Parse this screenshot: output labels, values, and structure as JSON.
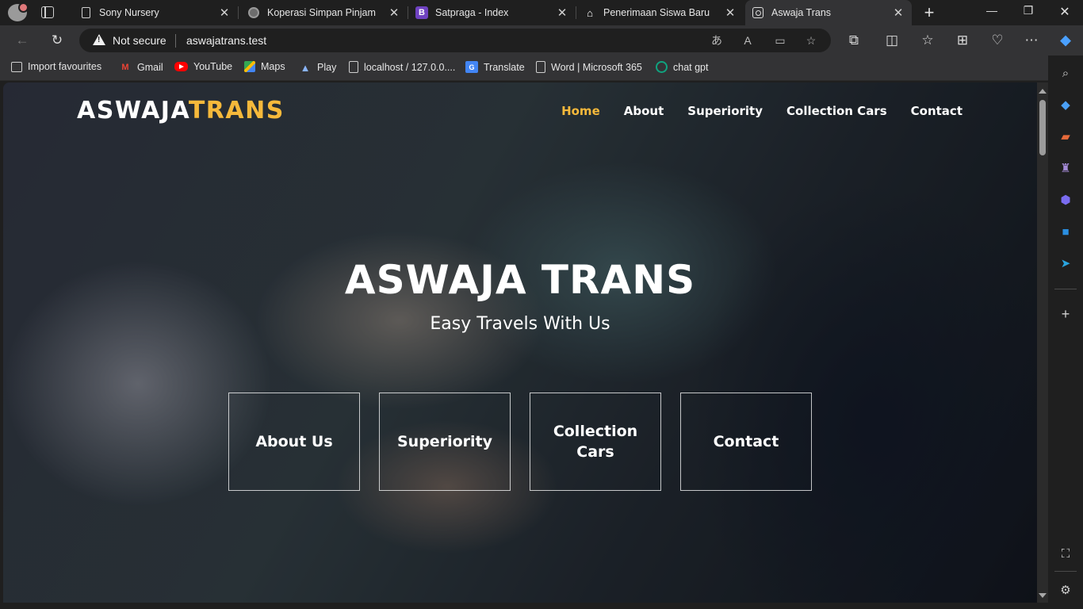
{
  "tabs": [
    {
      "title": "Sony Nursery",
      "icon": "page-icon"
    },
    {
      "title": "Koperasi Simpan Pinjam",
      "icon": "globe-icon"
    },
    {
      "title": "Satpraga - Index",
      "icon": "bootstrap-icon",
      "glyph": "B"
    },
    {
      "title": "Penerimaan Siswa Baru",
      "icon": "mask-icon"
    },
    {
      "title": "Aswaja Trans",
      "icon": "site-icon",
      "active": true
    }
  ],
  "address": {
    "security_label": "Not secure",
    "url": "aswajatrans.test"
  },
  "bookmarks": [
    {
      "label": "Import favourites",
      "icon": "import-icon"
    },
    {
      "label": "Gmail",
      "icon": "gmail-icon",
      "glyph": "M"
    },
    {
      "label": "YouTube",
      "icon": "youtube-icon"
    },
    {
      "label": "Maps",
      "icon": "maps-icon"
    },
    {
      "label": "Play",
      "icon": "play-icon"
    },
    {
      "label": "localhost / 127.0.0....",
      "icon": "page-icon"
    },
    {
      "label": "Translate",
      "icon": "translate-icon",
      "glyph": "G"
    },
    {
      "label": "Word | Microsoft 365",
      "icon": "page-icon"
    },
    {
      "label": "chat gpt",
      "icon": "chatgpt-icon"
    }
  ],
  "site": {
    "logo_main": "ASWAJA",
    "logo_accent": "TRANS",
    "nav": [
      "Home",
      "About",
      "Superiority",
      "Collection Cars",
      "Contact"
    ],
    "hero_title": "ASWAJA TRANS",
    "hero_subtitle": "Easy Travels With Us",
    "cards": [
      "About Us",
      "Superiority",
      "Collection Cars",
      "Contact"
    ]
  },
  "colors": {
    "accent": "#f6b93b",
    "chrome_bg": "#1f1f1f",
    "toolbar_bg": "#333335"
  }
}
